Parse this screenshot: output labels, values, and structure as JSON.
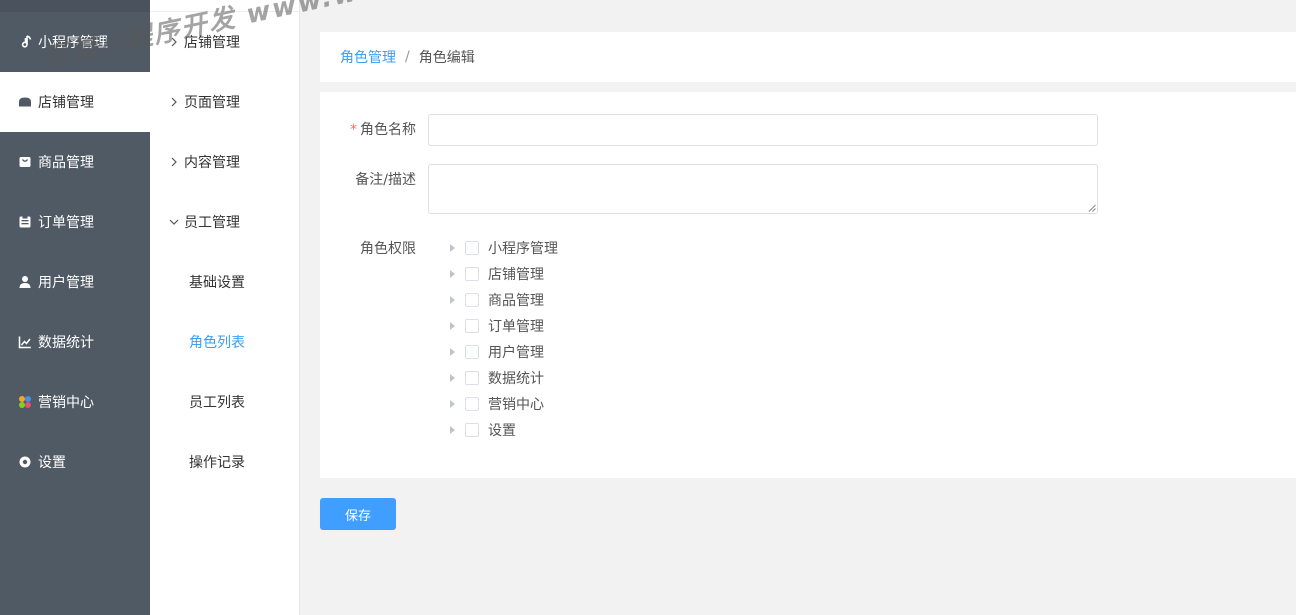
{
  "sidebar": {
    "items": [
      {
        "label": "小程序管理",
        "icon": "music-note-icon"
      },
      {
        "label": "店铺管理",
        "icon": "store-icon"
      },
      {
        "label": "商品管理",
        "icon": "bag-icon"
      },
      {
        "label": "订单管理",
        "icon": "order-icon"
      },
      {
        "label": "用户管理",
        "icon": "user-icon"
      },
      {
        "label": "数据统计",
        "icon": "chart-icon"
      },
      {
        "label": "营销中心",
        "icon": "marketing-icon"
      },
      {
        "label": "设置",
        "icon": "settings-icon"
      }
    ],
    "active_index": 1
  },
  "subnav": {
    "groups": [
      {
        "label": "店铺管理",
        "expanded": false
      },
      {
        "label": "页面管理",
        "expanded": false
      },
      {
        "label": "内容管理",
        "expanded": false
      },
      {
        "label": "员工管理",
        "expanded": true
      }
    ],
    "items": [
      {
        "label": "基础设置",
        "active": false
      },
      {
        "label": "角色列表",
        "active": true
      },
      {
        "label": "员工列表",
        "active": false
      },
      {
        "label": "操作记录",
        "active": false
      }
    ]
  },
  "breadcrumb": {
    "parent": "角色管理",
    "separator": "/",
    "current": "角色编辑"
  },
  "form": {
    "name_label": "角色名称",
    "name_required_mark": "*",
    "name_value": "",
    "desc_label": "备注/描述",
    "desc_value": "",
    "perm_label": "角色权限",
    "permissions": [
      "小程序管理",
      "店铺管理",
      "商品管理",
      "订单管理",
      "用户管理",
      "数据统计",
      "营销中心",
      "设置"
    ]
  },
  "actions": {
    "save_label": "保存"
  },
  "watermark": {
    "text": "商城小程序开发 www.weike.cc"
  },
  "colors": {
    "sidebar_bg": "#505a64",
    "accent": "#409eff",
    "link": "#3a9ff5",
    "required": "#f56c6c"
  }
}
